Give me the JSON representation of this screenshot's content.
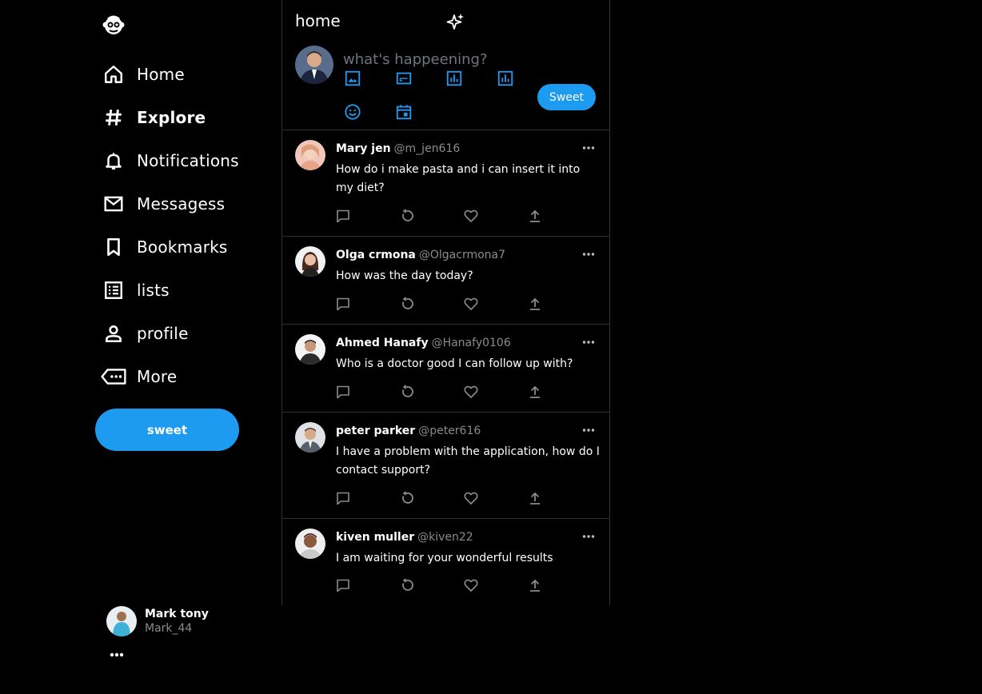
{
  "sidebar": {
    "logo_icon": "monkey-logo-icon",
    "items": [
      {
        "label": "Home",
        "icon": "home-icon"
      },
      {
        "label": "Explore",
        "icon": "hashtag-icon",
        "active": true
      },
      {
        "label": "Notifications",
        "icon": "bell-icon"
      },
      {
        "label": "Messagess",
        "icon": "mail-icon"
      },
      {
        "label": "Bookmarks",
        "icon": "bookmark-icon"
      },
      {
        "label": "lists",
        "icon": "list-icon"
      },
      {
        "label": "profile",
        "icon": "person-icon"
      },
      {
        "label": "More",
        "icon": "more-tag-icon"
      }
    ],
    "sweet_label": "sweet",
    "user": {
      "name": "Mark tony",
      "handle": "Mark_44"
    }
  },
  "header": {
    "title": "home"
  },
  "composer": {
    "placeholder": "what's happeening?",
    "sweet_label": "Sweet",
    "tools": [
      "image-icon",
      "gif-icon",
      "poll-icon",
      "poll-icon",
      "emoji-icon",
      "schedule-icon"
    ]
  },
  "feed": [
    {
      "name": "Mary jen",
      "handle": "@m_jen616",
      "text": "How do i make pasta and i can insert it into my diet?"
    },
    {
      "name": "Olga crmona",
      "handle": "@Olgacrmona7",
      "text": "How was the day today?"
    },
    {
      "name": "Ahmed Hanafy",
      "handle": "@Hanafy0106",
      "text": "Who is a doctor good I can follow up with?"
    },
    {
      "name": "peter parker",
      "handle": "@peter616",
      "text": "I have a problem with the application, how do I contact support?"
    },
    {
      "name": "kiven muller",
      "handle": "@kiven22",
      "text": "I am waiting for your wonderful results"
    }
  ],
  "colors": {
    "accent": "#1d9bf0",
    "background": "#000000",
    "border": "#2f3336",
    "muted": "#8b8b8b"
  }
}
